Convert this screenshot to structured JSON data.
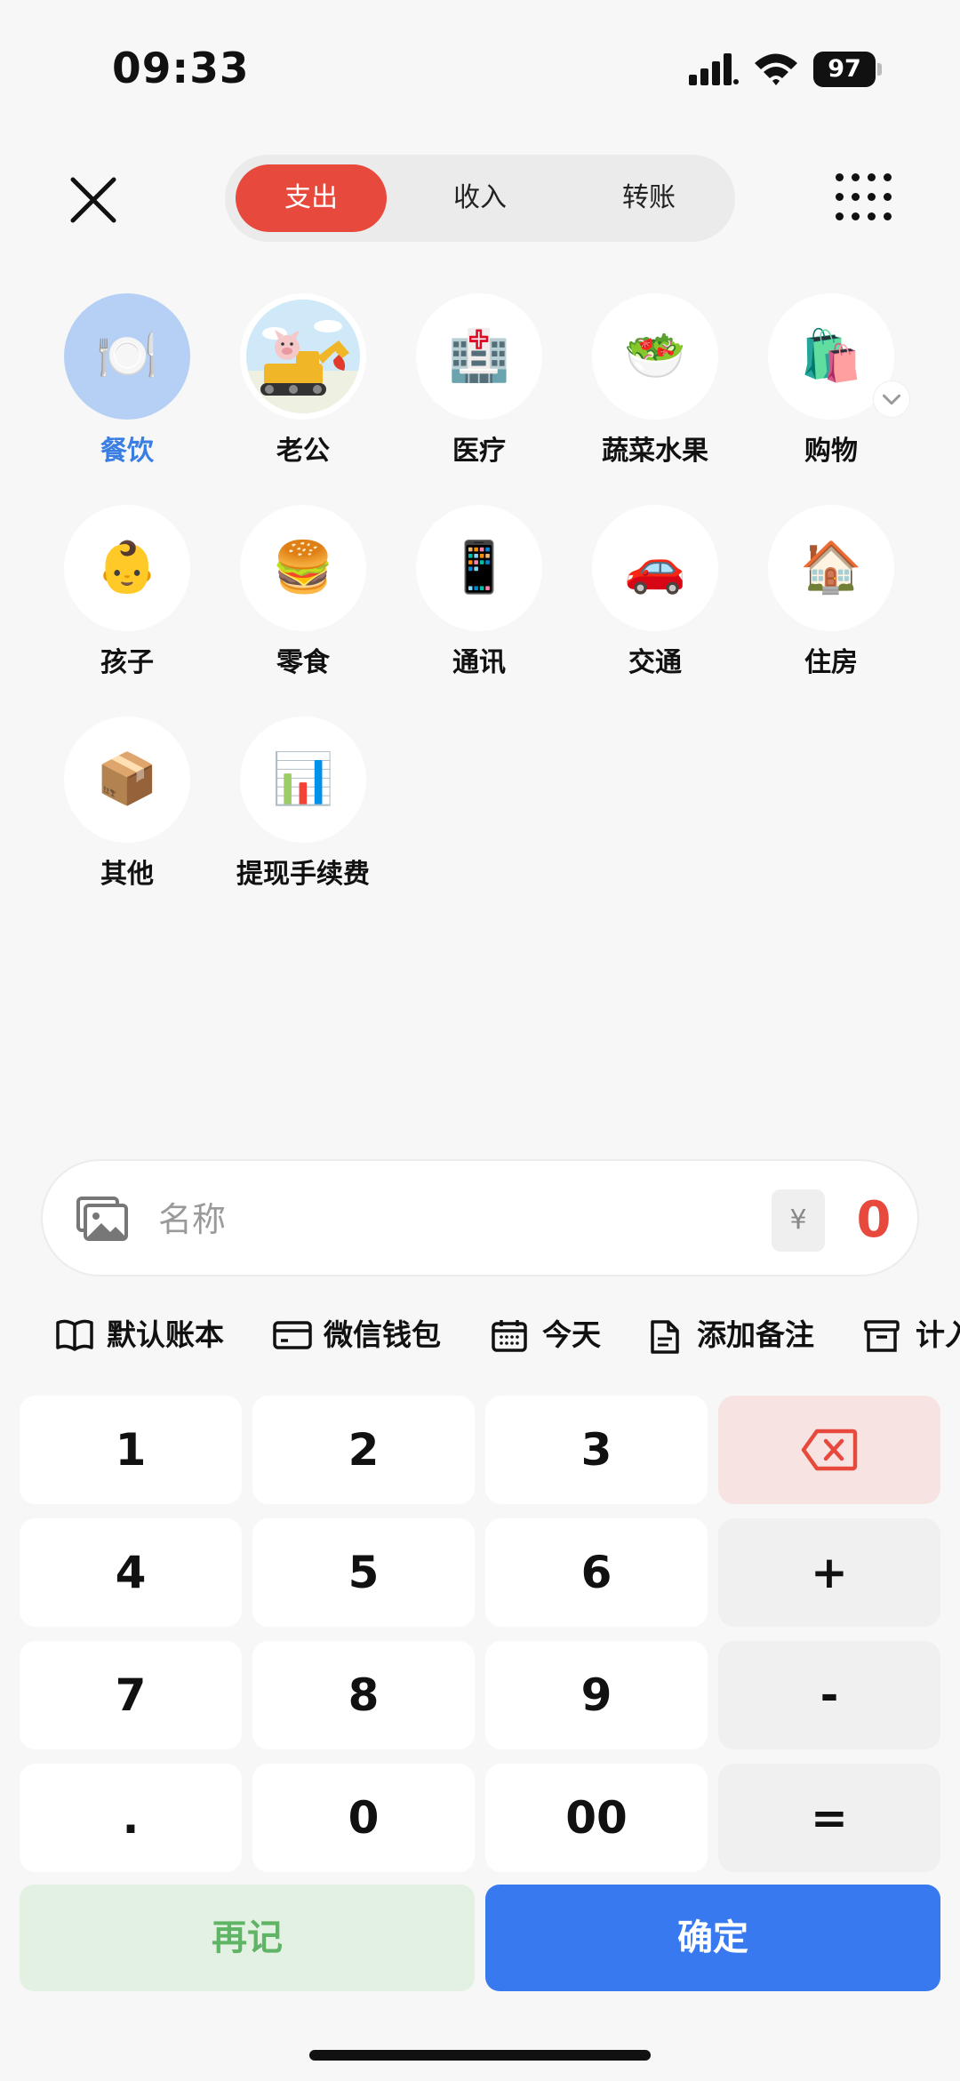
{
  "status_bar": {
    "time": "09:33",
    "battery": "97"
  },
  "header": {
    "tabs": [
      {
        "label": "支出",
        "active": true
      },
      {
        "label": "收入",
        "active": false
      },
      {
        "label": "转账",
        "active": false
      }
    ]
  },
  "categories": [
    {
      "label": "餐饮",
      "icon": "🍽️",
      "selected": true
    },
    {
      "label": "老公",
      "icon": "pig-excavator-avatar",
      "selected": false
    },
    {
      "label": "医疗",
      "icon": "🏥",
      "selected": false
    },
    {
      "label": "蔬菜水果",
      "icon": "🥗",
      "selected": false
    },
    {
      "label": "购物",
      "icon": "🛍️",
      "selected": false
    },
    {
      "label": "孩子",
      "icon": "👶",
      "selected": false
    },
    {
      "label": "零食",
      "icon": "🍔",
      "selected": false
    },
    {
      "label": "通讯",
      "icon": "📱",
      "selected": false
    },
    {
      "label": "交通",
      "icon": "🚗",
      "selected": false
    },
    {
      "label": "住房",
      "icon": "🏠",
      "selected": false
    },
    {
      "label": "其他",
      "icon": "📦",
      "selected": false
    },
    {
      "label": "提现手续费",
      "icon": "📊",
      "selected": false
    }
  ],
  "entry": {
    "name_placeholder": "名称",
    "currency": "¥",
    "amount": "0"
  },
  "options": [
    {
      "label": "默认账本",
      "icon": "book-icon"
    },
    {
      "label": "微信钱包",
      "icon": "card-icon"
    },
    {
      "label": "今天",
      "icon": "calendar-icon"
    },
    {
      "label": "添加备注",
      "icon": "note-icon"
    },
    {
      "label": "计入",
      "icon": "archive-icon"
    }
  ],
  "keypad": {
    "keys": [
      "1",
      "2",
      "3",
      "4",
      "5",
      "6",
      "7",
      "8",
      "9",
      ".",
      "0",
      "00"
    ],
    "ops": [
      "+",
      "-",
      "="
    ]
  },
  "actions": {
    "again": "再记",
    "confirm": "确定"
  },
  "colors": {
    "accent_red": "#e74a3d",
    "accent_blue": "#3879f0",
    "selected_bg": "#b6d0f5",
    "again_green": "#5fb466"
  }
}
